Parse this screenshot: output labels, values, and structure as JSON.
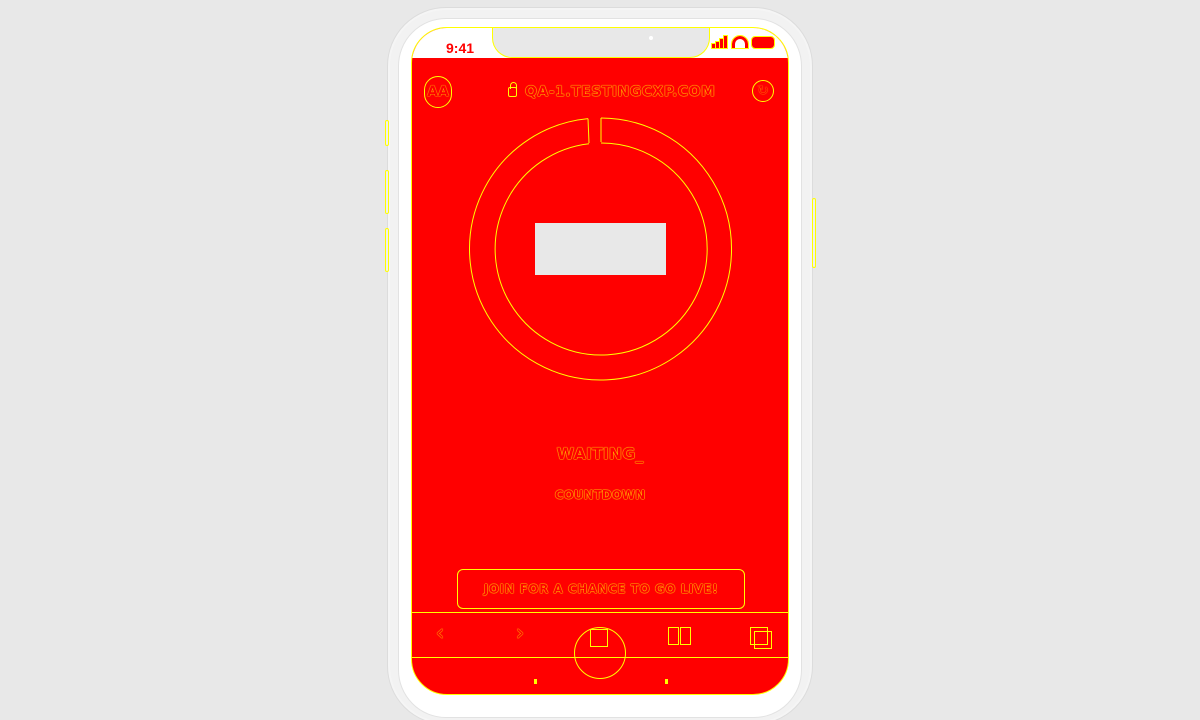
{
  "status_bar": {
    "time": "9:41",
    "icons": [
      "signal-icon",
      "wifi-icon",
      "battery-icon"
    ]
  },
  "browser": {
    "text_size_label": "AA",
    "url": "QA-1.TESTINGCXP.COM",
    "reload_icon": "↻"
  },
  "content": {
    "waiting_text": "WAITING_",
    "countdown_label": "COUNTDOWN",
    "join_button_label": "JOIN FOR A CHANCE TO GO LIVE!"
  },
  "toolbar": {
    "back_icon": "‹",
    "forward_icon": "›",
    "share_icon": "share-icon",
    "bookmarks_icon": "book-icon",
    "tabs_icon": "tabs-icon"
  },
  "colors": {
    "screen_background": "#ff0000",
    "outline": "#ffff00",
    "page_background": "#e8e8e8"
  }
}
